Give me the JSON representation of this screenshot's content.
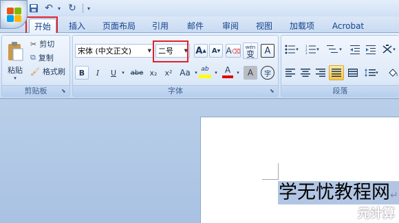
{
  "qat": {
    "save": "💾",
    "undo": "↶",
    "redo": "↻",
    "drop": "▾"
  },
  "tabs": [
    "开始",
    "插入",
    "页面布局",
    "引用",
    "邮件",
    "审阅",
    "视图",
    "加载项",
    "Acrobat"
  ],
  "clipboard": {
    "paste": "粘贴",
    "cut": "剪切",
    "copy": "复制",
    "format_painter": "格式刷",
    "label": "剪贴板"
  },
  "font": {
    "font_name": "宋体 (中文正文)",
    "font_size": "二号",
    "grow": "A",
    "shrink": "A",
    "clear": "A",
    "phonetic": "wén",
    "phonetic_char": "变",
    "border_char": "A",
    "bold": "B",
    "italic": "I",
    "underline": "U",
    "strike": "abe",
    "subscript": "x₂",
    "superscript": "x²",
    "case": "Aa",
    "highlight": "ab",
    "font_color": "A",
    "shading": "A",
    "enclose": "字",
    "label": "字体"
  },
  "paragraph": {
    "label": "段落"
  },
  "document": {
    "selected_text": "学无忧教程网",
    "para_mark": "↵"
  },
  "watermark": "元计算",
  "colors": {
    "red_box": "#e0202a",
    "selection": "#b2c6e4",
    "highlight_yellow": "#ffff00",
    "font_red": "#e00000"
  }
}
